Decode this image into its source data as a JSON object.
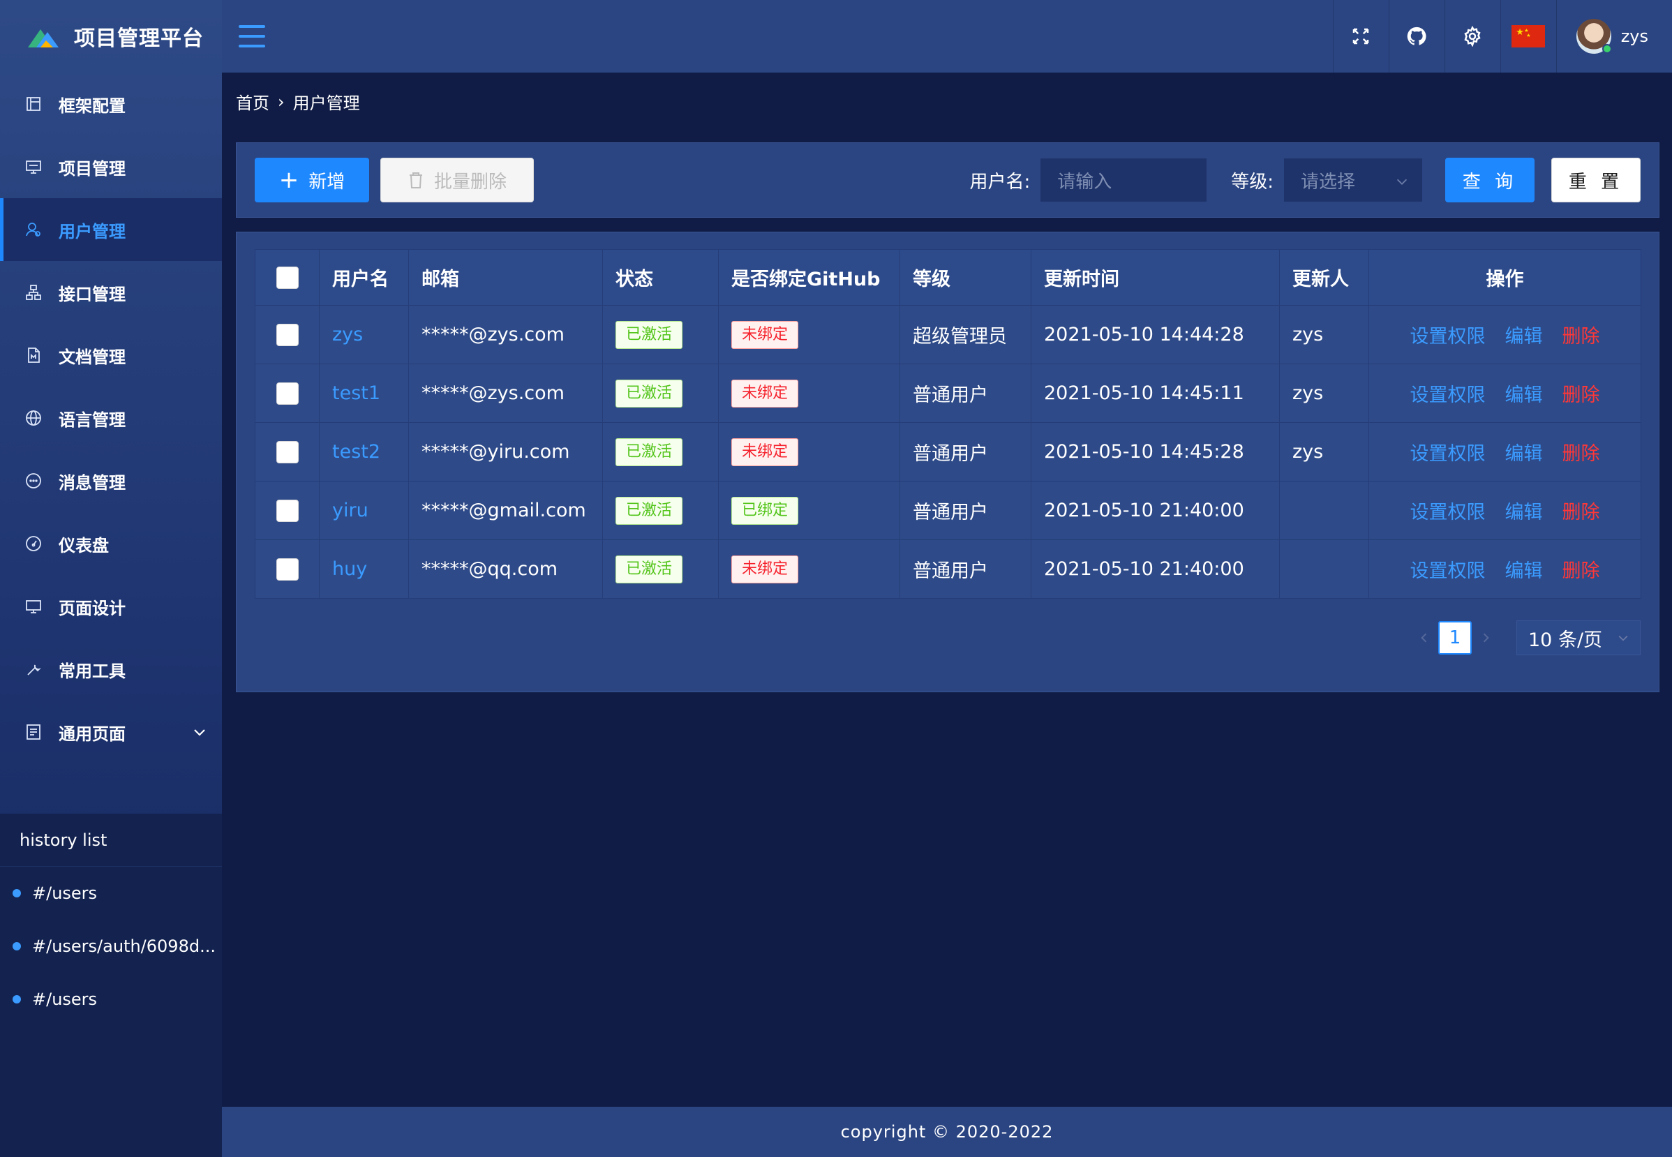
{
  "app": {
    "title": "项目管理平台"
  },
  "sidebar": {
    "items": [
      {
        "label": "框架配置",
        "icon": "layout-icon"
      },
      {
        "label": "项目管理",
        "icon": "monitor-sql-icon"
      },
      {
        "label": "用户管理",
        "icon": "user-icon",
        "active": true
      },
      {
        "label": "接口管理",
        "icon": "api-tree-icon"
      },
      {
        "label": "文档管理",
        "icon": "document-icon"
      },
      {
        "label": "语言管理",
        "icon": "globe-icon"
      },
      {
        "label": "消息管理",
        "icon": "message-icon"
      },
      {
        "label": "仪表盘",
        "icon": "dashboard-icon"
      },
      {
        "label": "页面设计",
        "icon": "desktop-icon"
      },
      {
        "label": "常用工具",
        "icon": "tool-icon"
      },
      {
        "label": "通用页面",
        "icon": "page-icon",
        "expandable": true
      }
    ]
  },
  "history": {
    "title": "history list",
    "items": [
      "#/users",
      "#/users/auth/6098d...",
      "#/users"
    ]
  },
  "header": {
    "username": "zys"
  },
  "breadcrumb": {
    "home": "首页",
    "separator": "›",
    "current": "用户管理"
  },
  "toolbar": {
    "add_label": "新增",
    "batch_delete_label": "批量删除",
    "username_label": "用户名:",
    "username_placeholder": "请输入",
    "level_label": "等级:",
    "level_placeholder": "请选择",
    "query_label": "查 询",
    "reset_label": "重 置"
  },
  "table": {
    "columns": [
      "用户名",
      "邮箱",
      "状态",
      "是否绑定GitHub",
      "等级",
      "更新时间",
      "更新人",
      "操作"
    ],
    "rows": [
      {
        "username": "zys",
        "email": "*****@zys.com",
        "status": "已激活",
        "github": "未绑定",
        "github_bound": false,
        "level": "超级管理员",
        "updated": "2021-05-10 14:44:28",
        "updater": "zys"
      },
      {
        "username": "test1",
        "email": "*****@zys.com",
        "status": "已激活",
        "github": "未绑定",
        "github_bound": false,
        "level": "普通用户",
        "updated": "2021-05-10 14:45:11",
        "updater": "zys"
      },
      {
        "username": "test2",
        "email": "*****@yiru.com",
        "status": "已激活",
        "github": "未绑定",
        "github_bound": false,
        "level": "普通用户",
        "updated": "2021-05-10 14:45:28",
        "updater": "zys"
      },
      {
        "username": "yiru",
        "email": "*****@gmail.com",
        "status": "已激活",
        "github": "已绑定",
        "github_bound": true,
        "level": "普通用户",
        "updated": "2021-05-10 21:40:00",
        "updater": ""
      },
      {
        "username": "huy",
        "email": "*****@qq.com",
        "status": "已激活",
        "github": "未绑定",
        "github_bound": false,
        "level": "普通用户",
        "updated": "2021-05-10 21:40:00",
        "updater": ""
      }
    ],
    "actions": {
      "permissions": "设置权限",
      "edit": "编辑",
      "delete": "删除"
    }
  },
  "pagination": {
    "current_page": "1",
    "page_size": "10 条/页"
  },
  "footer": {
    "copyright": "copyright © 2020-2022"
  },
  "colors": {
    "primary": "#1e88ff",
    "danger": "#ff3838",
    "success": "#52c41a",
    "sidebar": "#2e4a86",
    "background": "#101c45"
  }
}
